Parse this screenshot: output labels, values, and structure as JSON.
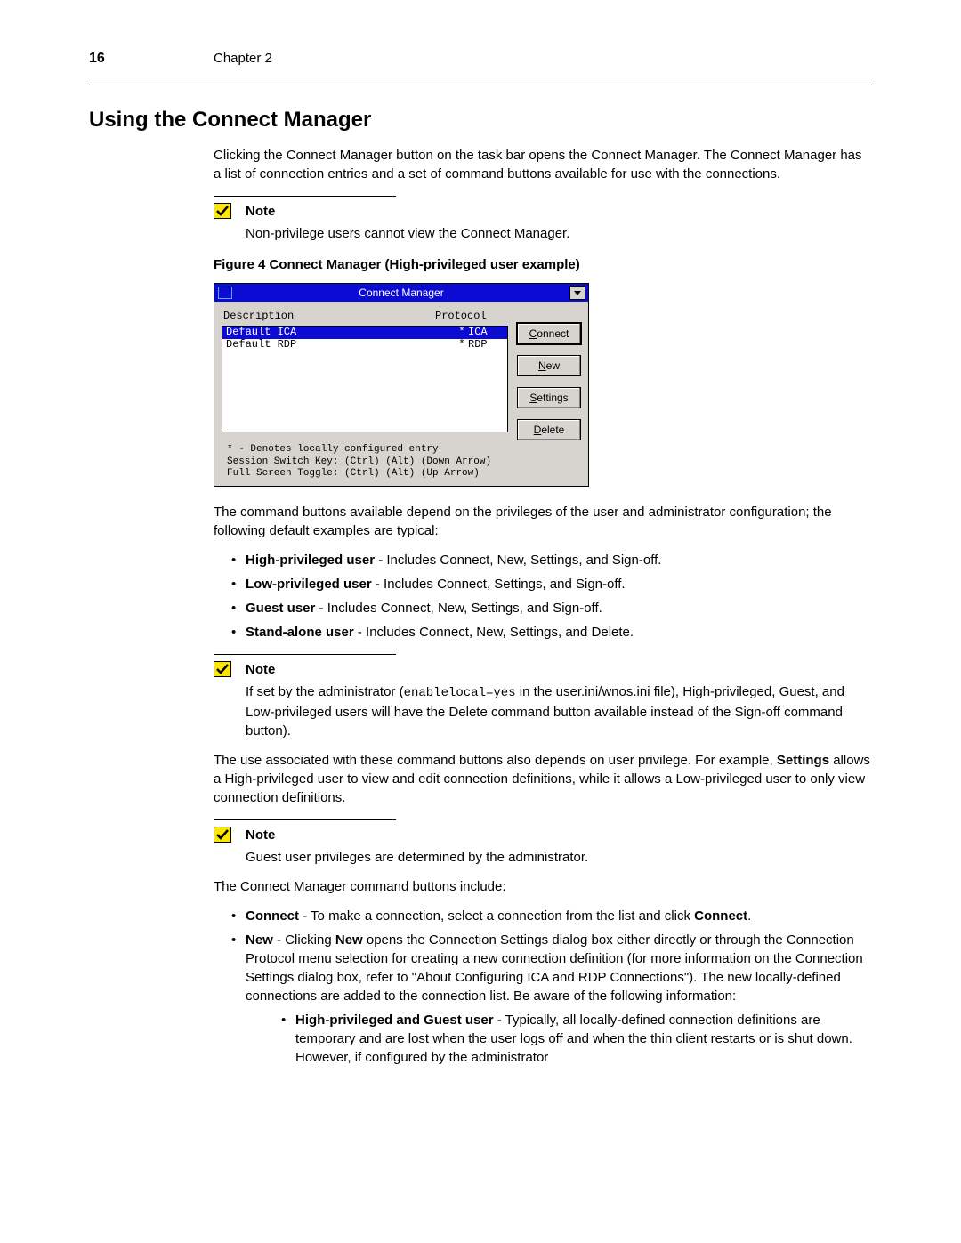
{
  "header": {
    "page_number": "16",
    "chapter": "Chapter 2"
  },
  "section_title": "Using the Connect Manager",
  "intro_para": "Clicking the Connect Manager button on the task bar opens the Connect Manager. The Connect Manager has a list of connection entries and a set of command buttons available for use with the connections.",
  "note1": {
    "label": "Note",
    "text": "Non-privilege users cannot view the Connect Manager."
  },
  "figure_caption": "Figure 4    Connect Manager (High-privileged user example)",
  "cm": {
    "title": "Connect Manager",
    "col_desc": "Description",
    "col_prot": "Protocol",
    "rows": [
      {
        "desc": "Default ICA",
        "mark": "*",
        "prot": "ICA",
        "selected": true
      },
      {
        "desc": "Default RDP",
        "mark": "*",
        "prot": "RDP",
        "selected": false
      }
    ],
    "buttons": {
      "connect": "Connect",
      "new": "New",
      "settings": "Settings",
      "delete": "Delete"
    },
    "footer_l1": "* - Denotes locally configured entry",
    "footer_l2": "Session Switch Key: (Ctrl) (Alt) (Down Arrow)",
    "footer_l3": "Full Screen Toggle: (Ctrl) (Alt) (Up   Arrow)"
  },
  "commands_intro": "The command buttons available depend on the privileges of the user and administrator configuration; the following default examples are typical:",
  "priv_list": [
    {
      "b": "High-privileged user",
      "t": " - Includes Connect, New, Settings, and Sign-off."
    },
    {
      "b": "Low-privileged user",
      "t": " - Includes Connect, Settings, and Sign-off."
    },
    {
      "b": "Guest user",
      "t": " - Includes Connect, New, Settings, and Sign-off."
    },
    {
      "b": "Stand-alone user",
      "t": " - Includes Connect, New, Settings, and Delete."
    }
  ],
  "note2": {
    "label": "Note",
    "pre": "If set by the administrator (",
    "code": "enablelocal=yes",
    "post": " in the user.ini/wnos.ini file), High-privileged, Guest, and Low-privileged users will have the Delete command button available instead of the Sign-off command button)."
  },
  "use_para_pre": "The use associated with these command buttons also depends on user privilege. For example, ",
  "use_para_b": "Settings",
  "use_para_post": " allows a High-privileged user to view and edit connection definitions, while it allows a Low-privileged user to only view connection definitions.",
  "note3": {
    "label": "Note",
    "text": "Guest user privileges are determined by the administrator."
  },
  "cmd_intro2": "The Connect Manager command buttons include:",
  "cmd_list": {
    "connect": {
      "b": "Connect",
      "t1": " - To make a connection, select a connection from the list and click ",
      "b2": "Connect",
      "t2": "."
    },
    "new": {
      "b": "New",
      "t1": " - Clicking ",
      "b2": "New",
      "t2": " opens the Connection Settings dialog box either directly or through the Connection Protocol menu selection for creating a new connection definition (for more information on the Connection Settings dialog box, refer to \"About Configuring ICA and RDP Connections\"). The new locally-defined connections are added to the connection list. Be aware of the following information:"
    },
    "sub1": {
      "b": "High-privileged and Guest user",
      "t": " - Typically, all locally-defined connection definitions are temporary and are lost when the user logs off and when the thin client restarts or is shut down. However, if configured by the administrator"
    }
  }
}
